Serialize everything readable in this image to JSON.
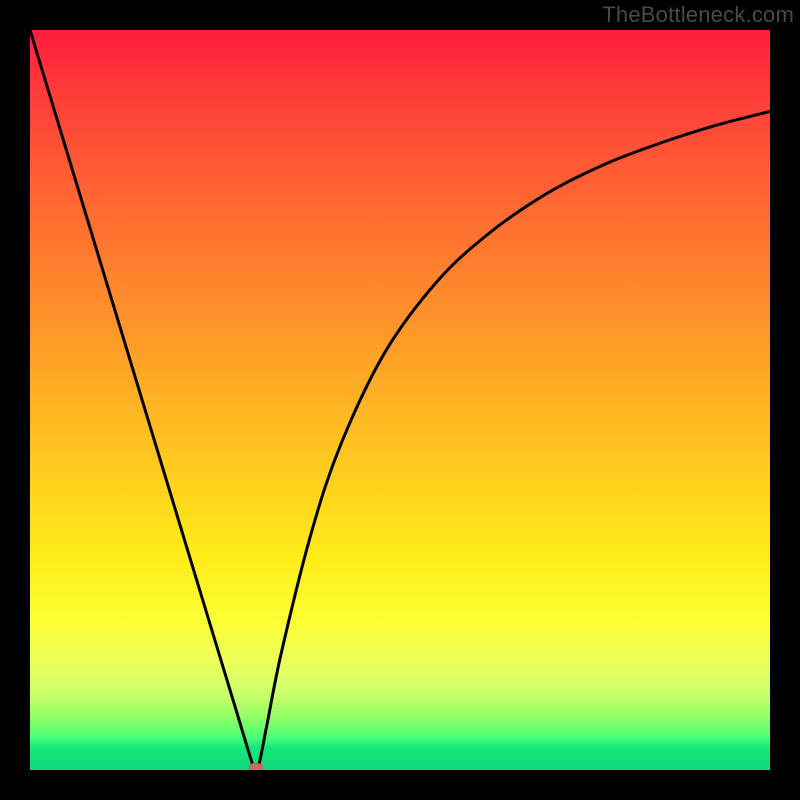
{
  "watermark": "TheBottleneck.com",
  "colors": {
    "frame": "#000000",
    "curve": "#000000",
    "marker": "#c96a5a",
    "gradient_top": "#ff1e3c",
    "gradient_bottom": "#0fd97a"
  },
  "chart_data": {
    "type": "line",
    "title": "",
    "xlabel": "",
    "ylabel": "",
    "xlim": [
      0,
      1
    ],
    "ylim": [
      0,
      1
    ],
    "series": [
      {
        "name": "curve",
        "x": [
          0.0,
          0.05,
          0.1,
          0.15,
          0.2,
          0.25,
          0.28,
          0.3,
          0.305,
          0.31,
          0.32,
          0.34,
          0.38,
          0.42,
          0.48,
          0.55,
          0.62,
          0.7,
          0.78,
          0.86,
          0.93,
          1.0
        ],
        "y": [
          1.0,
          0.835,
          0.67,
          0.505,
          0.34,
          0.175,
          0.076,
          0.01,
          0.0,
          0.01,
          0.06,
          0.16,
          0.32,
          0.44,
          0.565,
          0.66,
          0.725,
          0.78,
          0.82,
          0.85,
          0.872,
          0.89
        ]
      }
    ],
    "annotations": [
      {
        "name": "min-marker",
        "x": 0.305,
        "y": 0.0
      }
    ]
  }
}
